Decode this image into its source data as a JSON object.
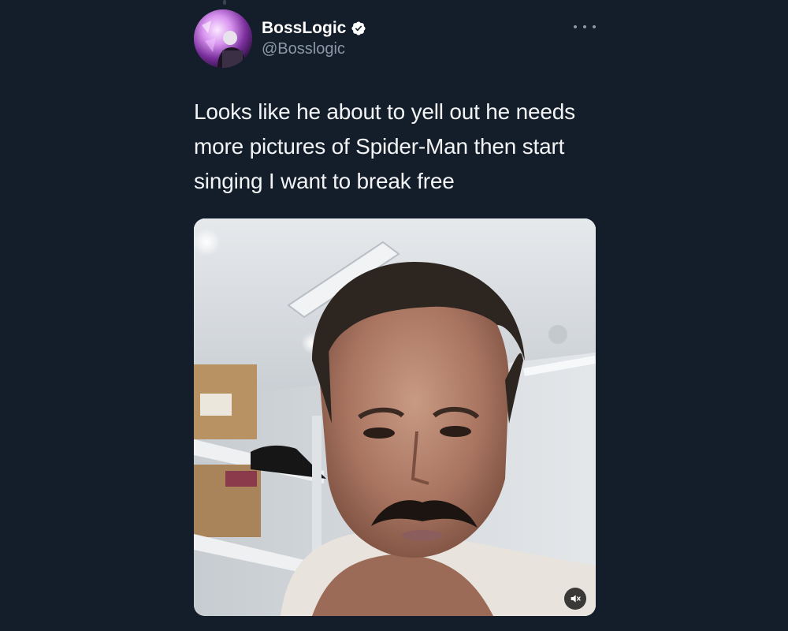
{
  "tweet": {
    "display_name": "BossLogic",
    "handle": "@Bosslogic",
    "verified": true,
    "text": "Looks like he about to yell out he needs more pictures of Spider-Man then start singing I want to break free",
    "media": {
      "type": "video",
      "muted": true
    }
  },
  "icons": {
    "verified": "verified-badge-icon",
    "more": "more-options-icon",
    "mute": "speaker-muted-icon"
  },
  "colors": {
    "background": "#141d2a",
    "text_primary": "#ffffff",
    "text_secondary": "#8b98a5",
    "verified_badge": "#ffffff"
  }
}
